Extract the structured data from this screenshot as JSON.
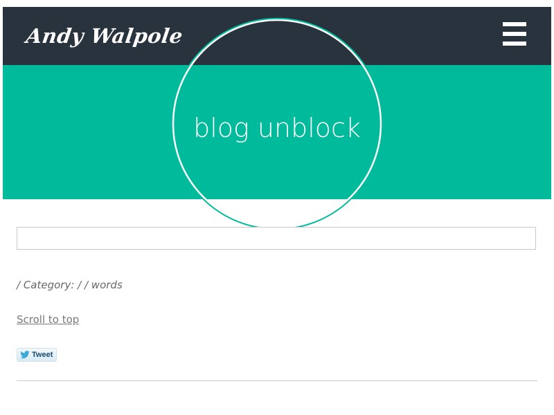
{
  "header": {
    "logo_text": "Andy Walpole",
    "menu_icon": "hamburger-menu-icon"
  },
  "hero": {
    "title": "blog unblock"
  },
  "search": {
    "value": "",
    "placeholder": ""
  },
  "post": {
    "meta": "/ Category: / / words",
    "scroll_link": "Scroll to top",
    "tweet_label": "Tweet",
    "tweet_icon": "twitter-bird-icon"
  },
  "colors": {
    "header_bg": "#28333d",
    "accent": "#00bb9b",
    "text_muted": "#666666"
  }
}
